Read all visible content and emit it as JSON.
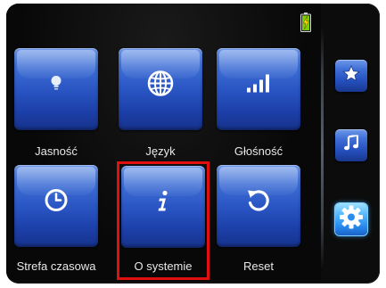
{
  "settings_menu": {
    "tiles": [
      {
        "label": "Jasność",
        "icon": "brightness-icon"
      },
      {
        "label": "Język",
        "icon": "globe-icon"
      },
      {
        "label": "Głośność",
        "icon": "volume-bars-icon"
      },
      {
        "label": "Strefa czasowa",
        "icon": "clock-icon"
      },
      {
        "label": "O systemie",
        "icon": "info-icon"
      },
      {
        "label": "Reset",
        "icon": "reset-arrow-icon"
      }
    ],
    "selected_tile": "O systemie"
  },
  "sidebar": {
    "items": [
      {
        "icon": "star-icon",
        "active": false
      },
      {
        "icon": "music-note-icon",
        "active": false
      },
      {
        "icon": "gear-icon",
        "active": true
      }
    ]
  },
  "status": {
    "battery_icon": "battery-charging-icon"
  },
  "colors": {
    "tile_blue": "#2a56c4",
    "selection_red": "#e01010",
    "active_blue": "#2a8ef0",
    "battery_green": "#7ad000",
    "battery_bolt": "#ffd400"
  }
}
